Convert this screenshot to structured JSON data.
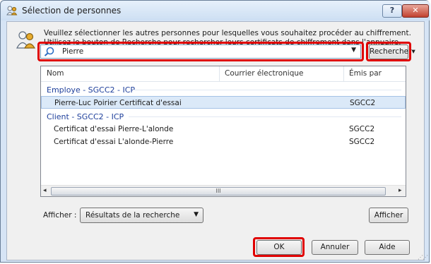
{
  "window": {
    "title": "Sélection de personnes",
    "help_label": "?",
    "close_label": "✕"
  },
  "instructions": "Veuillez sélectionner les autres personnes pour lesquelles vous souhaitez procéder au chiffrement.  Utilisez le bouton de Recherche pour rechercher leurs certificats de chiffrement dans l'annuaire.",
  "search": {
    "value": "Pierre",
    "button_label": "Rechercher",
    "button_arrow": "▾"
  },
  "table": {
    "headers": [
      "Nom",
      "Courrier électronique",
      "Émis par"
    ],
    "groups": [
      {
        "label": "Employe - SGCC2 - ICP",
        "rows": [
          {
            "name": "Pierre-Luc Poirier Certificat d'essai",
            "email": "",
            "issuer": "SGCC2",
            "selected": true
          }
        ]
      },
      {
        "label": "Client - SGCC2 - ICP",
        "rows": [
          {
            "name": "Certificat d'essai Pierre-L'alonde",
            "email": "",
            "issuer": "SGCC2",
            "selected": false
          },
          {
            "name": "Certificat d'essai L'alonde-Pierre",
            "email": "",
            "issuer": "SGCC2",
            "selected": false
          }
        ]
      }
    ],
    "scroll_left": "◂",
    "scroll_right": "▸",
    "scroll_grip": "III"
  },
  "footer": {
    "show_label": "Afficher :",
    "show_select_value": "Résultats de la recherche",
    "show_button": "Afficher",
    "ok": "OK",
    "cancel": "Annuler",
    "help": "Aide"
  },
  "colors": {
    "highlight": "#e00000",
    "group_text": "#1e3f9b",
    "selection": "#dbe9f8"
  },
  "icons": {
    "title": "people-icon",
    "search": "magnifier-icon",
    "dropdown": "chevron-down-icon"
  }
}
